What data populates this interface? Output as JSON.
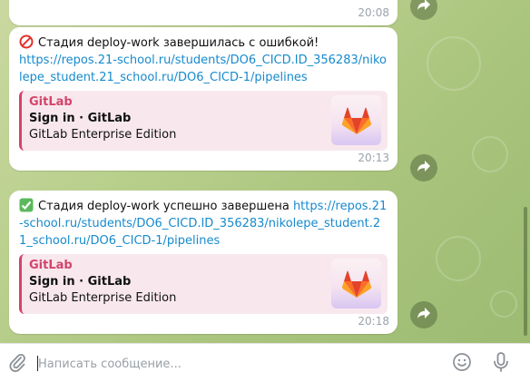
{
  "messages": [
    {
      "time": "20:08"
    },
    {
      "status_emoji": "no-entry-emoji",
      "text": "Стадия  deploy-work завершилась с ошибкой!",
      "link": "https://repos.21-school.ru/students/DO6_CICD.ID_356283/nikolepe_student.21_school.ru/DO6_CICD-1/pipelines",
      "preview": {
        "site": "GitLab",
        "title": "Sign in · GitLab",
        "description": "GitLab Enterprise Edition"
      },
      "time": "20:13"
    },
    {
      "status_emoji": "check-mark-emoji",
      "text": "Стадия  deploy-work успешно завершена",
      "link": "https://repos.21-school.ru/students/DO6_CICD.ID_356283/nikolepe_student.21_school.ru/DO6_CICD-1/pipelines",
      "preview": {
        "site": "GitLab",
        "title": "Sign in · GitLab",
        "description": "GitLab Enterprise Edition"
      },
      "time": "20:18"
    }
  ],
  "composer": {
    "placeholder": "Написать сообщение...",
    "value": ""
  },
  "icons": {
    "attach": "paperclip-icon",
    "emoji": "smiley-icon",
    "mic": "microphone-icon",
    "forward": "share-arrow-icon"
  },
  "colors": {
    "link": "#168acd",
    "gitlab_accent": "#d5436a",
    "preview_bg": "#f8e8ee",
    "chat_bg": "#b8cf8c"
  }
}
